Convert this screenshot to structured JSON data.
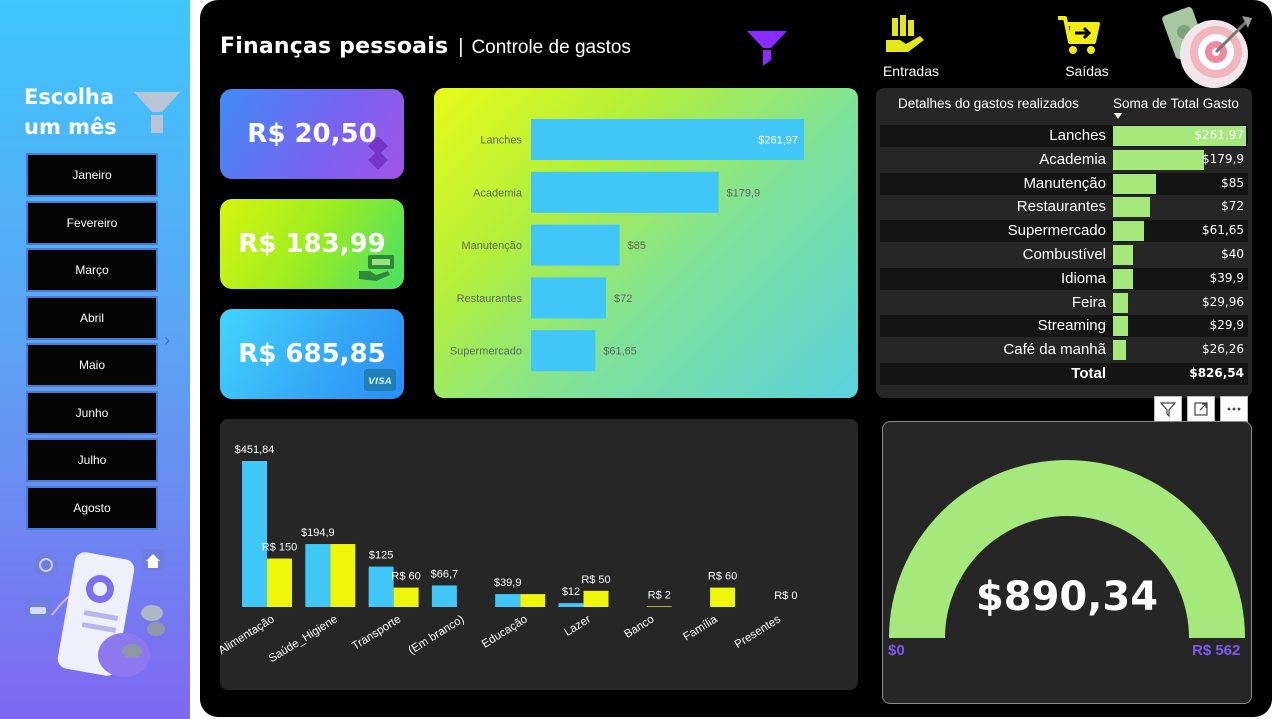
{
  "sidebar": {
    "title": "Escolha um mês",
    "months": [
      "Janeiro",
      "Fevereiro",
      "Março",
      "Abril",
      "Maio",
      "Junho",
      "Julho",
      "Agosto"
    ]
  },
  "header": {
    "title": "Finanças pessoais",
    "separator": "|",
    "subtitle": "Controle de gastos",
    "nav": {
      "entradas": "Entradas",
      "saidas": "Saídas"
    }
  },
  "kpis": [
    {
      "value": "R$ 20,50",
      "icon": "pix-icon"
    },
    {
      "value": "R$ 183,99",
      "icon": "cash-payment-icon"
    },
    {
      "value": "R$ 685,85",
      "icon": "visa-card-icon"
    }
  ],
  "table": {
    "col1": "Detalhes do gastos realizados",
    "col2": "Soma de Total Gasto",
    "rows": [
      {
        "label": "Lanches",
        "value": 261.97,
        "display": "$261,97"
      },
      {
        "label": "Academia",
        "value": 179.9,
        "display": "$179,9"
      },
      {
        "label": "Manutenção",
        "value": 85,
        "display": "$85"
      },
      {
        "label": "Restaurantes",
        "value": 72,
        "display": "$72"
      },
      {
        "label": "Supermercado",
        "value": 61.65,
        "display": "$61,65"
      },
      {
        "label": "Combustível",
        "value": 40,
        "display": "$40"
      },
      {
        "label": "Idioma",
        "value": 39.9,
        "display": "$39,9"
      },
      {
        "label": "Feira",
        "value": 29.96,
        "display": "$29,96"
      },
      {
        "label": "Streaming",
        "value": 29.9,
        "display": "$29,9"
      },
      {
        "label": "Café da manhã",
        "value": 26.26,
        "display": "$26,26"
      }
    ],
    "total_label": "Total",
    "total_value": "$826,54"
  },
  "visual_header_icons": [
    "filter-icon",
    "focus-mode-icon",
    "more-options-icon"
  ],
  "gauge": {
    "value": "$890,34",
    "min_label": "$0",
    "max_label": "R$ 562",
    "fill_fraction": 1.0,
    "fill_color": "#a5e87c",
    "label_color": "#7b5cf0"
  },
  "chart_data": [
    {
      "type": "bar",
      "orientation": "horizontal",
      "categories": [
        "Lanches",
        "Academia",
        "Manutenção",
        "Restaurantes",
        "Supermercado"
      ],
      "values": [
        261.97,
        179.9,
        85,
        72,
        61.65
      ],
      "data_labels": [
        "$261,97",
        "$179,9",
        "$85",
        "$72",
        "$61,65"
      ],
      "color": "#41c6f8",
      "xlim": [
        0,
        261.97
      ]
    },
    {
      "type": "bar",
      "orientation": "vertical",
      "categories": [
        "Alimentação",
        "Saúde_Higiene",
        "Transporte",
        "(Em branco)",
        "Educação",
        "Lazer",
        "Banco",
        "Família",
        "Presentes"
      ],
      "series": [
        {
          "values": [
            451.84,
            194.9,
            125,
            66.7,
            39.9,
            12,
            0,
            0,
            0
          ],
          "labels": [
            "$451,84",
            "$194,9",
            "$125",
            "$66,7",
            "$39,9",
            "$12",
            "",
            "",
            ""
          ],
          "color": "#41c6f8"
        },
        {
          "values": [
            150,
            194.9,
            60,
            0,
            39.9,
            50,
            2,
            60,
            0
          ],
          "labels": [
            "R$ 150",
            "",
            "R$ 60",
            "",
            "",
            "R$ 50",
            "R$ 2",
            "R$ 60",
            "R$ 0"
          ],
          "color": "#eef70a"
        }
      ],
      "ylim": [
        0,
        451.84
      ]
    }
  ]
}
